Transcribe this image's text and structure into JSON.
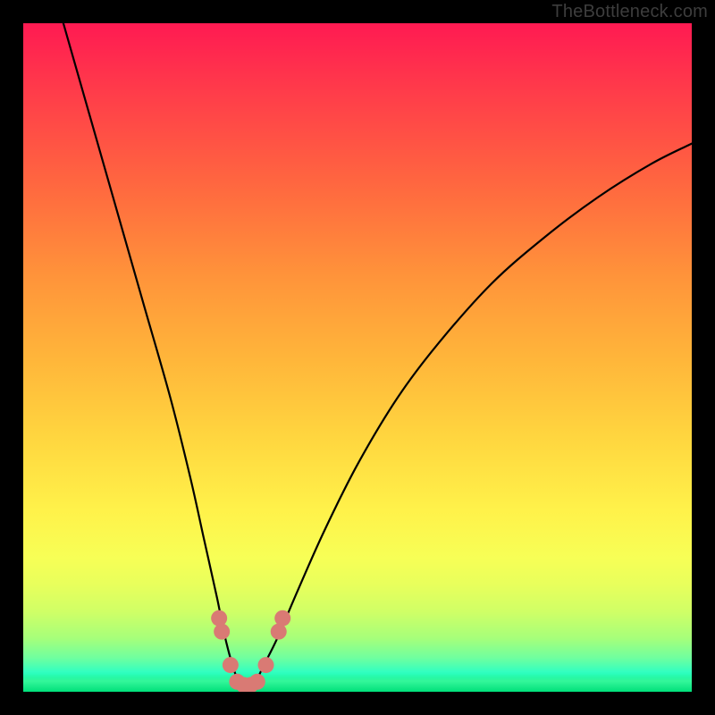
{
  "watermark": "TheBottleneck.com",
  "chart_data": {
    "type": "line",
    "title": "",
    "xlabel": "",
    "ylabel": "",
    "xlim": [
      0,
      100
    ],
    "ylim": [
      0,
      100
    ],
    "grid": false,
    "legend": false,
    "series": [
      {
        "name": "bottleneck-curve",
        "x": [
          6,
          10,
          14,
          18,
          22,
          25,
          27,
          29,
          30,
          31,
          32,
          33,
          34,
          35,
          36,
          38,
          41,
          45,
          50,
          56,
          62,
          70,
          78,
          86,
          94,
          100
        ],
        "y": [
          100,
          86,
          72,
          58,
          44,
          32,
          23,
          14,
          9,
          5,
          2,
          1,
          1,
          2,
          4,
          8,
          15,
          24,
          34,
          44,
          52,
          61,
          68,
          74,
          79,
          82
        ]
      }
    ],
    "markers": [
      {
        "name": "left-upper-dot",
        "x": 29.3,
        "y": 11.0
      },
      {
        "name": "left-upper-dot2",
        "x": 29.7,
        "y": 9.0
      },
      {
        "name": "left-lower-dot",
        "x": 31.0,
        "y": 4.0
      },
      {
        "name": "trough-dot-1",
        "x": 32.0,
        "y": 1.5
      },
      {
        "name": "trough-dot-2",
        "x": 33.0,
        "y": 1.0
      },
      {
        "name": "trough-dot-3",
        "x": 34.0,
        "y": 1.0
      },
      {
        "name": "trough-dot-4",
        "x": 35.0,
        "y": 1.5
      },
      {
        "name": "right-lower-dot",
        "x": 36.3,
        "y": 4.0
      },
      {
        "name": "right-upper-dot",
        "x": 38.2,
        "y": 9.0
      },
      {
        "name": "right-upper-dot2",
        "x": 38.8,
        "y": 11.0
      }
    ],
    "marker_color": "#d97a74",
    "curve_color": "#000000"
  }
}
